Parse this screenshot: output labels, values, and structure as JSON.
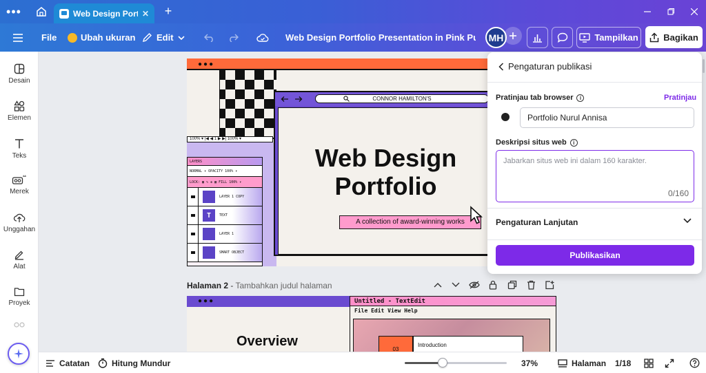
{
  "browser": {
    "tab_title": "Web Design Portfol...",
    "tab_close": "✕",
    "new_tab": "+"
  },
  "toolbar": {
    "file": "File",
    "resize": "Ubah ukuran",
    "edit": "Edit",
    "doc_title": "Web Design Portfolio Presentation in Pink Purple Or...",
    "avatar": "MH",
    "present": "Tampilkan",
    "share": "Bagikan"
  },
  "sidebar": {
    "items": [
      {
        "label": "Desain",
        "icon": "design-icon"
      },
      {
        "label": "Elemen",
        "icon": "elements-icon"
      },
      {
        "label": "Teks",
        "icon": "text-icon"
      },
      {
        "label": "Merek",
        "icon": "brand-icon"
      },
      {
        "label": "Unggahan",
        "icon": "upload-icon"
      },
      {
        "label": "Alat",
        "icon": "tools-icon"
      },
      {
        "label": "Proyek",
        "icon": "folder-icon"
      }
    ]
  },
  "slide1": {
    "url_text": "CONNOR HAMILTON'S",
    "title_line1": "Web Design",
    "title_line2": "Portfolio",
    "subtitle": "A collection of award-winning works",
    "status_strip": "100% ▾  |◀ ◀  1  ▶ ▶|  100% ▾",
    "layers_header": "LAYERS",
    "layers_normal": "NORMAL ▾   OPACITY  100% ▾",
    "layers_lock": "LOCK: ▦ ✎ ✥ ▦   FILL  100% ▾",
    "layers": [
      {
        "name": "LAYER 1 COPY",
        "thumb": ""
      },
      {
        "name": "TEXT",
        "thumb": "T"
      },
      {
        "name": "LAYER 1",
        "thumb": ""
      },
      {
        "name": "SMART OBJECT",
        "thumb": ""
      }
    ]
  },
  "page2": {
    "label": "Halaman 2",
    "sub": "Tambahkan judul halaman",
    "title": "Overview",
    "te_title": "Untitled - TextEdit",
    "te_menu": "File  Edit  View  Help",
    "intro_num": "03",
    "intro_label": "Introduction"
  },
  "panel": {
    "back": "Pengaturan publikasi",
    "tab_preview_label": "Pratinjau tab browser",
    "preview_link": "Pratinjau",
    "tab_value": "Portfolio Nurul Annisa",
    "desc_label": "Deskripsi situs web",
    "desc_placeholder": "Jabarkan situs web ini dalam 160 karakter.",
    "counter": "0/160",
    "advanced": "Pengaturan Lanjutan",
    "publish": "Publikasikan"
  },
  "bottom": {
    "notes": "Catatan",
    "timer": "Hitung Mundur",
    "zoom": "37%",
    "zoom_fraction": 0.37,
    "pages": "Halaman",
    "page_count": "1/18"
  },
  "colors": {
    "accent": "#7d2ae8",
    "slide_orange": "#ff6a3a",
    "slide_purple": "#6a4bd0",
    "slide_pink": "#ff9bcd"
  }
}
